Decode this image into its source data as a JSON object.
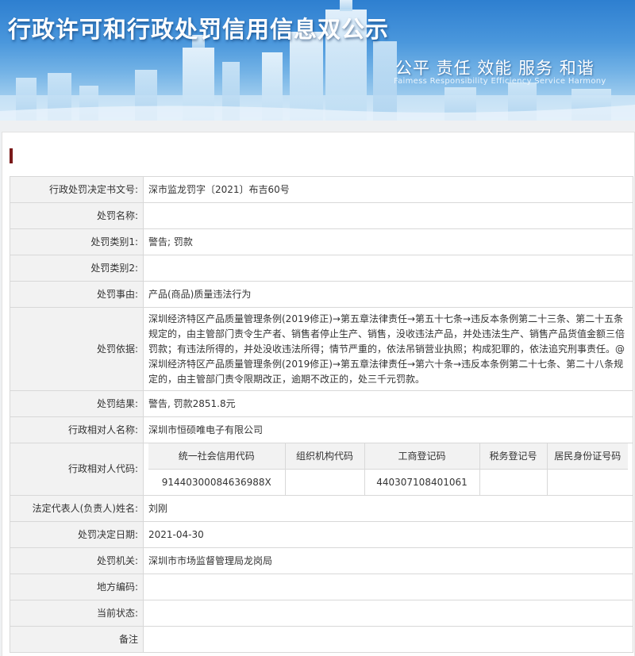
{
  "banner": {
    "title": "行政许可和行政处罚信用信息双公示",
    "slogan_cn": "公平  责任  效能  服务  和谐",
    "slogan_en": "Faimess  Responsibility  Efficiency  Service  Harmony"
  },
  "record": {
    "decision_no": {
      "label": "行政处罚决定书文号:",
      "value": "深市监龙罚字〔2021〕布吉60号"
    },
    "name": {
      "label": "处罚名称:",
      "value": ""
    },
    "category1": {
      "label": "处罚类别1:",
      "value": "警告; 罚款"
    },
    "category2": {
      "label": "处罚类别2:",
      "value": ""
    },
    "reason": {
      "label": "处罚事由:",
      "value": "产品(商品)质量违法行为"
    },
    "basis": {
      "label": "处罚依据:",
      "value": "深圳经济特区产品质量管理条例(2019修正)→第五章法律责任→第五十七条→违反本条例第二十三条、第二十五条规定的，由主管部门责令生产者、销售者停止生产、销售，没收违法产品，并处违法生产、销售产品货值金额三倍罚款；有违法所得的，并处没收违法所得；情节严重的，依法吊销营业执照；构成犯罪的，依法追究刑事责任。@深圳经济特区产品质量管理条例(2019修正)→第五章法律责任→第六十条→违反本条例第二十七条、第二十八条规定的，由主管部门责令限期改正，逾期不改正的，处三千元罚款。"
    },
    "result": {
      "label": "处罚结果:",
      "value": "警告, 罚款2851.8元"
    },
    "party_name": {
      "label": "行政相对人名称:",
      "value": "深圳市恒硕唯电子有限公司"
    },
    "party_code": {
      "label": "行政相对人代码:",
      "headers": [
        "统一社会信用代码",
        "组织机构代码",
        "工商登记码",
        "税务登记号",
        "居民身份证号码"
      ],
      "values": [
        "91440300084636988X",
        "",
        "440307108401061",
        "",
        ""
      ]
    },
    "legal_rep": {
      "label": "法定代表人(负责人)姓名:",
      "value": "刘刚"
    },
    "decision_date": {
      "label": "处罚决定日期:",
      "value": "2021-04-30"
    },
    "authority": {
      "label": "处罚机关:",
      "value": "深圳市市场监督管理局龙岗局"
    },
    "local_code": {
      "label": "地方编码:",
      "value": ""
    },
    "status": {
      "label": "当前状态:",
      "value": ""
    },
    "remark": {
      "label": "备注",
      "value": ""
    }
  }
}
